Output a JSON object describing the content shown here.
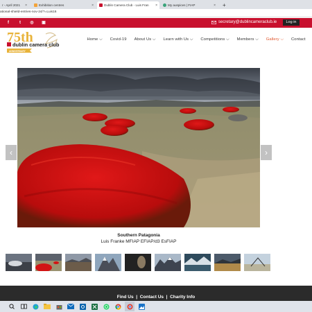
{
  "browser": {
    "tabs": [
      {
        "label": "r - April 2021",
        "active": false
      },
      {
        "label": "Exhibition centres",
        "active": false
      },
      {
        "label": "Dublin Camera Club - Luis Fran",
        "active": true
      },
      {
        "label": "My auspices | FIAP",
        "active": false
      }
    ],
    "url": "ational-shield-entries-nov-24/?=Luis16"
  },
  "topbar": {
    "email": "secretary@dublincameraclub.ie",
    "login_label": "Log in",
    "social_icons": [
      "f",
      "t",
      "◎",
      "▣"
    ]
  },
  "logo": {
    "anniversary": "75th",
    "name": "dublin camera club",
    "ribbon": "ANNIVERSARY"
  },
  "nav": {
    "items": [
      {
        "label": "Home ⌵",
        "active": false
      },
      {
        "label": "Covid-19",
        "active": false
      },
      {
        "label": "About Us ⌵",
        "active": false
      },
      {
        "label": "Learn with Us ⌵",
        "active": false
      },
      {
        "label": "Competitions ⌵",
        "active": false
      },
      {
        "label": "Members ⌵",
        "active": false
      },
      {
        "label": "Gallery ⌵",
        "active": true
      },
      {
        "label": "Contact",
        "active": false
      }
    ]
  },
  "gallery": {
    "title": "Southern Patagonia",
    "author": "Luis Franke MFIAP EFIAP/d3 EsFIAP",
    "prev_arrow": "‹",
    "next_arrow": "›",
    "thumb_count": 10
  },
  "footer": {
    "link1": "Find Us",
    "link2": "Contact Us",
    "link3": "Charity Info",
    "sep": "|"
  },
  "colors": {
    "brand": "#c8102e",
    "nav_active": "#e0542a",
    "footer": "#2b2b2b"
  }
}
